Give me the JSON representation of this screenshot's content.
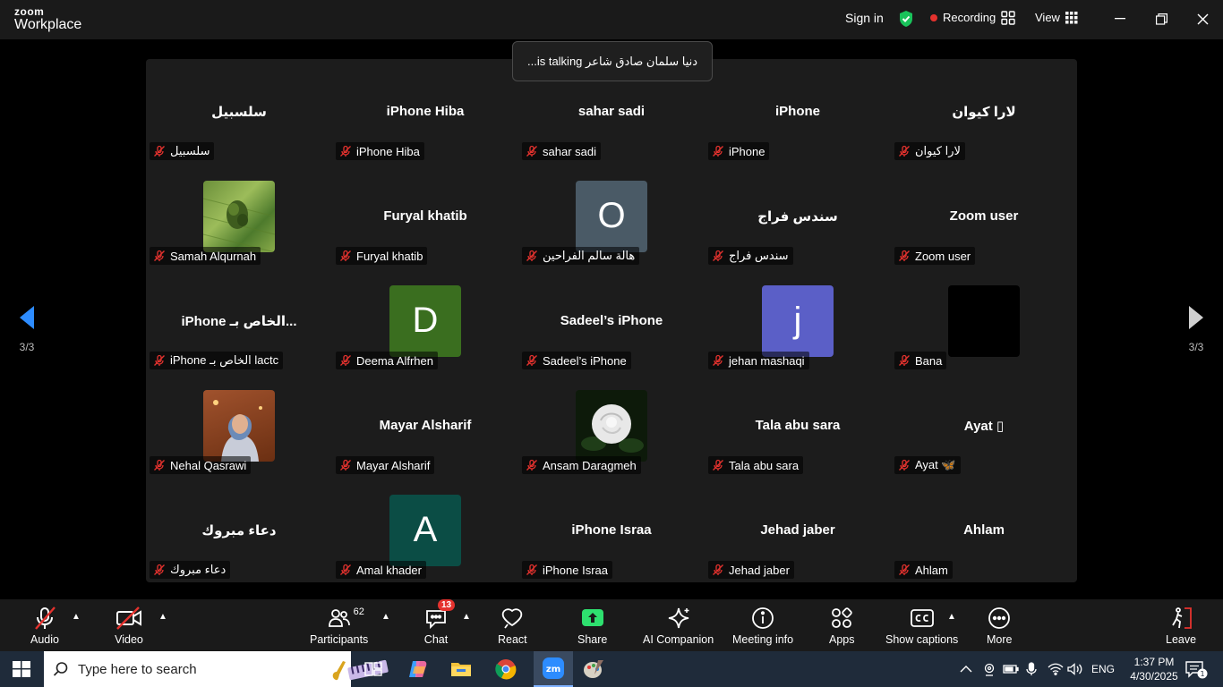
{
  "window": {
    "logo_line1": "zoom",
    "logo_line2": "Workplace",
    "sign_in": "Sign in",
    "recording": "Recording",
    "view": "View"
  },
  "talking_indicator": "دنيا سلمان صادق شاعر is talking...",
  "pagination": {
    "left": "3/3",
    "right": "3/3"
  },
  "participants_grid": [
    [
      {
        "title": "سلسبيل",
        "label": "سلسبيل",
        "avatar": null
      },
      {
        "title": "iPhone Hiba",
        "label": "iPhone Hiba",
        "avatar": null,
        "muted": false
      },
      {
        "title": "sahar sadi",
        "label": "sahar sadi",
        "avatar": null
      },
      {
        "title": "iPhone",
        "label": "iPhone",
        "avatar": null
      },
      {
        "title": "لارا كيوان",
        "label": "لارا كيوان",
        "avatar": null
      }
    ],
    [
      {
        "title": "",
        "label": "Samah Alqurnah",
        "avatar": "photo-field"
      },
      {
        "title": "Furyal khatib",
        "label": "Furyal khatib",
        "avatar": null
      },
      {
        "title": "",
        "label": "هالة سالم الفراحين",
        "avatar": "letter",
        "letter": "O",
        "color": "#4a5a66"
      },
      {
        "title": "سندس فراج",
        "label": "سندس فراج",
        "avatar": null
      },
      {
        "title": "Zoom user",
        "label": "Zoom user",
        "avatar": null
      }
    ],
    [
      {
        "title": "iPhone الخاص بـ...",
        "label": "iPhone الخاص بـ lactc",
        "avatar": null
      },
      {
        "title": "",
        "label": "Deema Alfrhen",
        "avatar": "letter",
        "letter": "D",
        "color": "#3a6e1f"
      },
      {
        "title": "Sadeel’s iPhone",
        "label": "Sadeel’s iPhone",
        "avatar": null
      },
      {
        "title": "",
        "label": "jehan mashaqi",
        "avatar": "letter",
        "letter": "j",
        "color": "#5b5fc7"
      },
      {
        "title": "",
        "label": "Bana",
        "avatar": "black"
      }
    ],
    [
      {
        "title": "",
        "label": "Nehal Qasrawi",
        "avatar": "photo-person"
      },
      {
        "title": "Mayar Alsharif",
        "label": "Mayar Alsharif",
        "avatar": null
      },
      {
        "title": "",
        "label": "Ansam Daragmeh",
        "avatar": "photo-rose"
      },
      {
        "title": "Tala abu sara",
        "label": "Tala abu sara",
        "avatar": null
      },
      {
        "title": "Ayat ▯",
        "label": "Ayat 🦋",
        "avatar": null
      }
    ],
    [
      {
        "title": "دعاء مبروك",
        "label": "دعاء مبروك",
        "avatar": null
      },
      {
        "title": "",
        "label": "Amal khader",
        "avatar": "letter",
        "letter": "A",
        "color": "#0b4d45"
      },
      {
        "title": "iPhone Israa",
        "label": "iPhone Israa",
        "avatar": null
      },
      {
        "title": "Jehad jaber",
        "label": "Jehad jaber",
        "avatar": null
      },
      {
        "title": "Ahlam",
        "label": "Ahlam",
        "avatar": null
      }
    ]
  ],
  "toolbar": {
    "audio": "Audio",
    "video": "Video",
    "participants": "Participants",
    "participants_count": "62",
    "chat": "Chat",
    "chat_badge": "13",
    "react": "React",
    "share": "Share",
    "ai_companion": "AI Companion",
    "meeting_info": "Meeting info",
    "apps": "Apps",
    "show_captions": "Show captions",
    "more": "More",
    "leave": "Leave"
  },
  "taskbar": {
    "search_placeholder": "Type here to search",
    "language": "ENG",
    "time": "1:37 PM",
    "date": "4/30/2025",
    "notifications": "1"
  },
  "colors": {
    "share_green": "#2ee06f",
    "recording_red": "#e5322e",
    "muted_red": "#e5322e",
    "shield_green": "#19c25a"
  }
}
